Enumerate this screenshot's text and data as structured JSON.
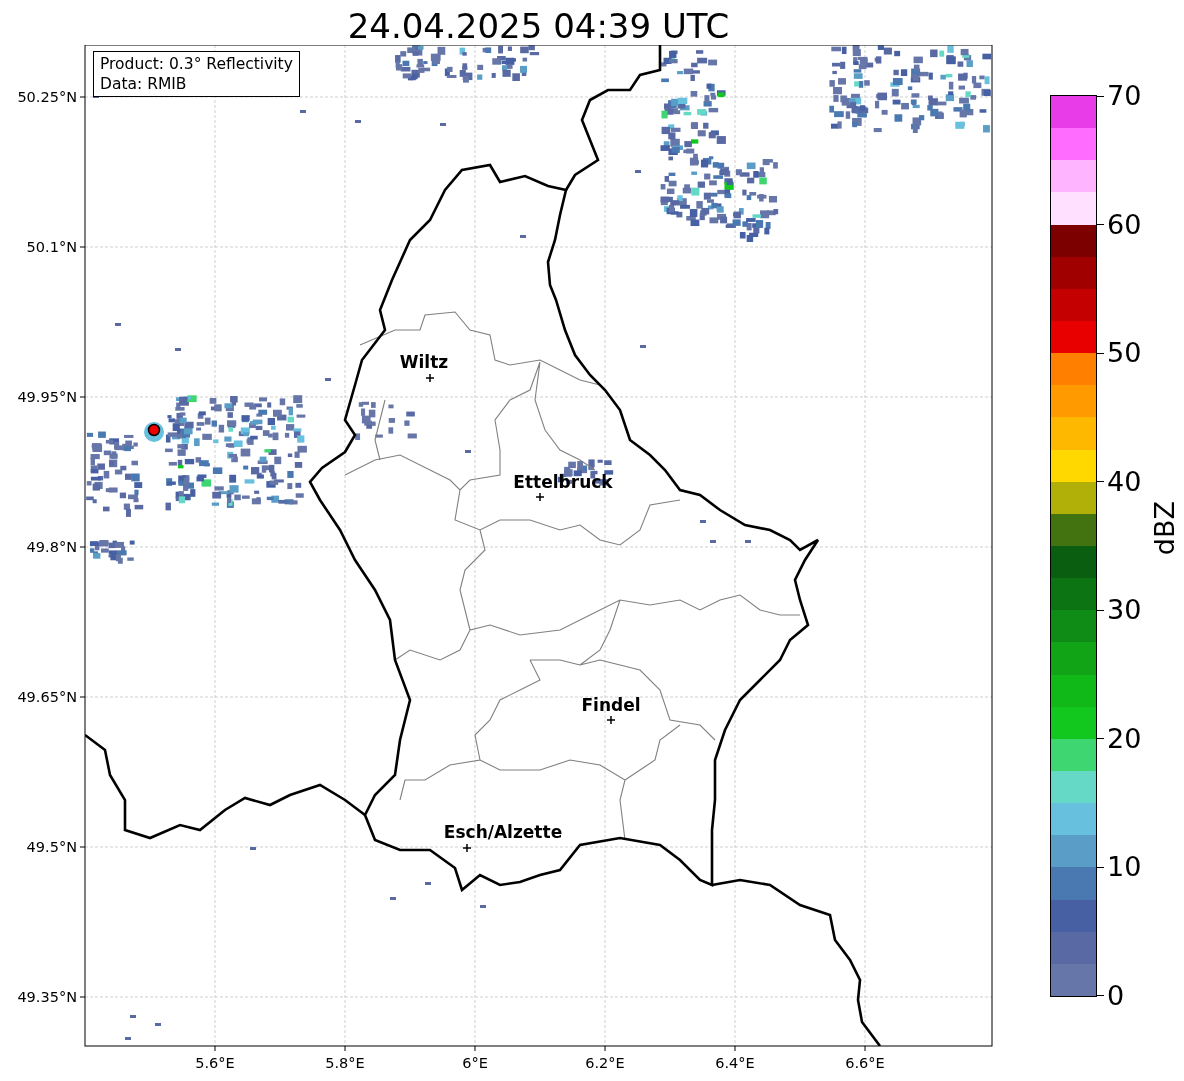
{
  "title": "24.04.2025 04:39 UTC",
  "info_box": [
    "Product: 0.3° Reflectivity",
    "Data: RMIB"
  ],
  "map": {
    "lat_ticks": [
      "50.25°N",
      "50.1°N",
      "49.95°N",
      "49.8°N",
      "49.65°N",
      "49.5°N",
      "49.35°N"
    ],
    "lon_ticks": [
      "5.6°E",
      "5.8°E",
      "6°E",
      "6.2°E",
      "6.4°E",
      "6.6°E"
    ],
    "places": [
      {
        "name": "Wiltz"
      },
      {
        "name": "Ettelbruck"
      },
      {
        "name": "Findel"
      },
      {
        "name": "Esch/Alzette"
      }
    ]
  },
  "colorbar": {
    "label": "dBZ",
    "ticks": [
      "70",
      "60",
      "50",
      "40",
      "30",
      "20",
      "10",
      "0"
    ],
    "segments": [
      {
        "color": "#e93ce9"
      },
      {
        "color": "#ff6cff"
      },
      {
        "color": "#ffb4ff"
      },
      {
        "color": "#ffe0ff"
      },
      {
        "color": "#7c0000"
      },
      {
        "color": "#a00000"
      },
      {
        "color": "#c40000"
      },
      {
        "color": "#e80000"
      },
      {
        "color": "#ff8000"
      },
      {
        "color": "#ff9a00"
      },
      {
        "color": "#ffb800"
      },
      {
        "color": "#ffd800"
      },
      {
        "color": "#b0b008"
      },
      {
        "color": "#437210"
      },
      {
        "color": "#0a5e10"
      },
      {
        "color": "#0c7412"
      },
      {
        "color": "#0e8c16"
      },
      {
        "color": "#10a416"
      },
      {
        "color": "#10b818"
      },
      {
        "color": "#12c81e"
      },
      {
        "color": "#3ed670"
      },
      {
        "color": "#66d8c6"
      },
      {
        "color": "#66c0de"
      },
      {
        "color": "#5a9ec8"
      },
      {
        "color": "#4a78b0"
      },
      {
        "color": "#4660a3"
      },
      {
        "color": "#5869a3"
      },
      {
        "color": "#6676a8"
      }
    ]
  }
}
